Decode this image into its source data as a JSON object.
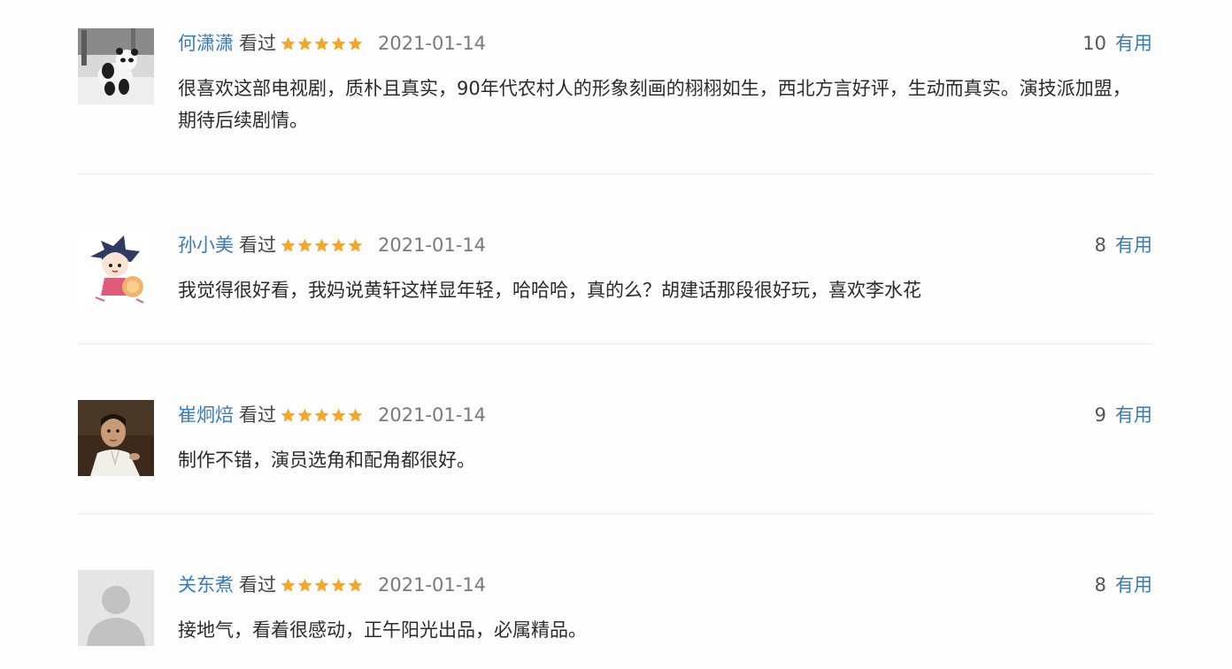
{
  "reviews": [
    {
      "username": "何潇潇",
      "status": "看过",
      "rating": 5,
      "date": "2021-01-14",
      "useful_count": "10",
      "useful_label": "有用",
      "comment": "很喜欢这部电视剧，质朴且真实，90年代农村人的形象刻画的栩栩如生，西北方言好评，生动而真实。演技派加盟，期待后续剧情。",
      "avatar_icon": "panda-avatar"
    },
    {
      "username": "孙小美",
      "status": "看过",
      "rating": 5,
      "date": "2021-01-14",
      "useful_count": "8",
      "useful_label": "有用",
      "comment": "我觉得很好看，我妈说黄轩这样显年轻，哈哈哈，真的么？胡建话那段很好玩，喜欢李水花",
      "avatar_icon": "cartoon-girl-avatar"
    },
    {
      "username": "崔炯焙",
      "status": "看过",
      "rating": 5,
      "date": "2021-01-14",
      "useful_count": "9",
      "useful_label": "有用",
      "comment": "制作不错，演员选角和配角都很好。",
      "avatar_icon": "man-photo-avatar"
    },
    {
      "username": "关东煮",
      "status": "看过",
      "rating": 5,
      "date": "2021-01-14",
      "useful_count": "8",
      "useful_label": "有用",
      "comment": "接地气，看着很感动，正午阳光出品，必属精品。",
      "avatar_icon": "default-user-avatar"
    }
  ],
  "colors": {
    "username": "#3a7ab8",
    "star": "#f5a623",
    "date": "#7a7a7a",
    "divider": "#ebebeb"
  }
}
